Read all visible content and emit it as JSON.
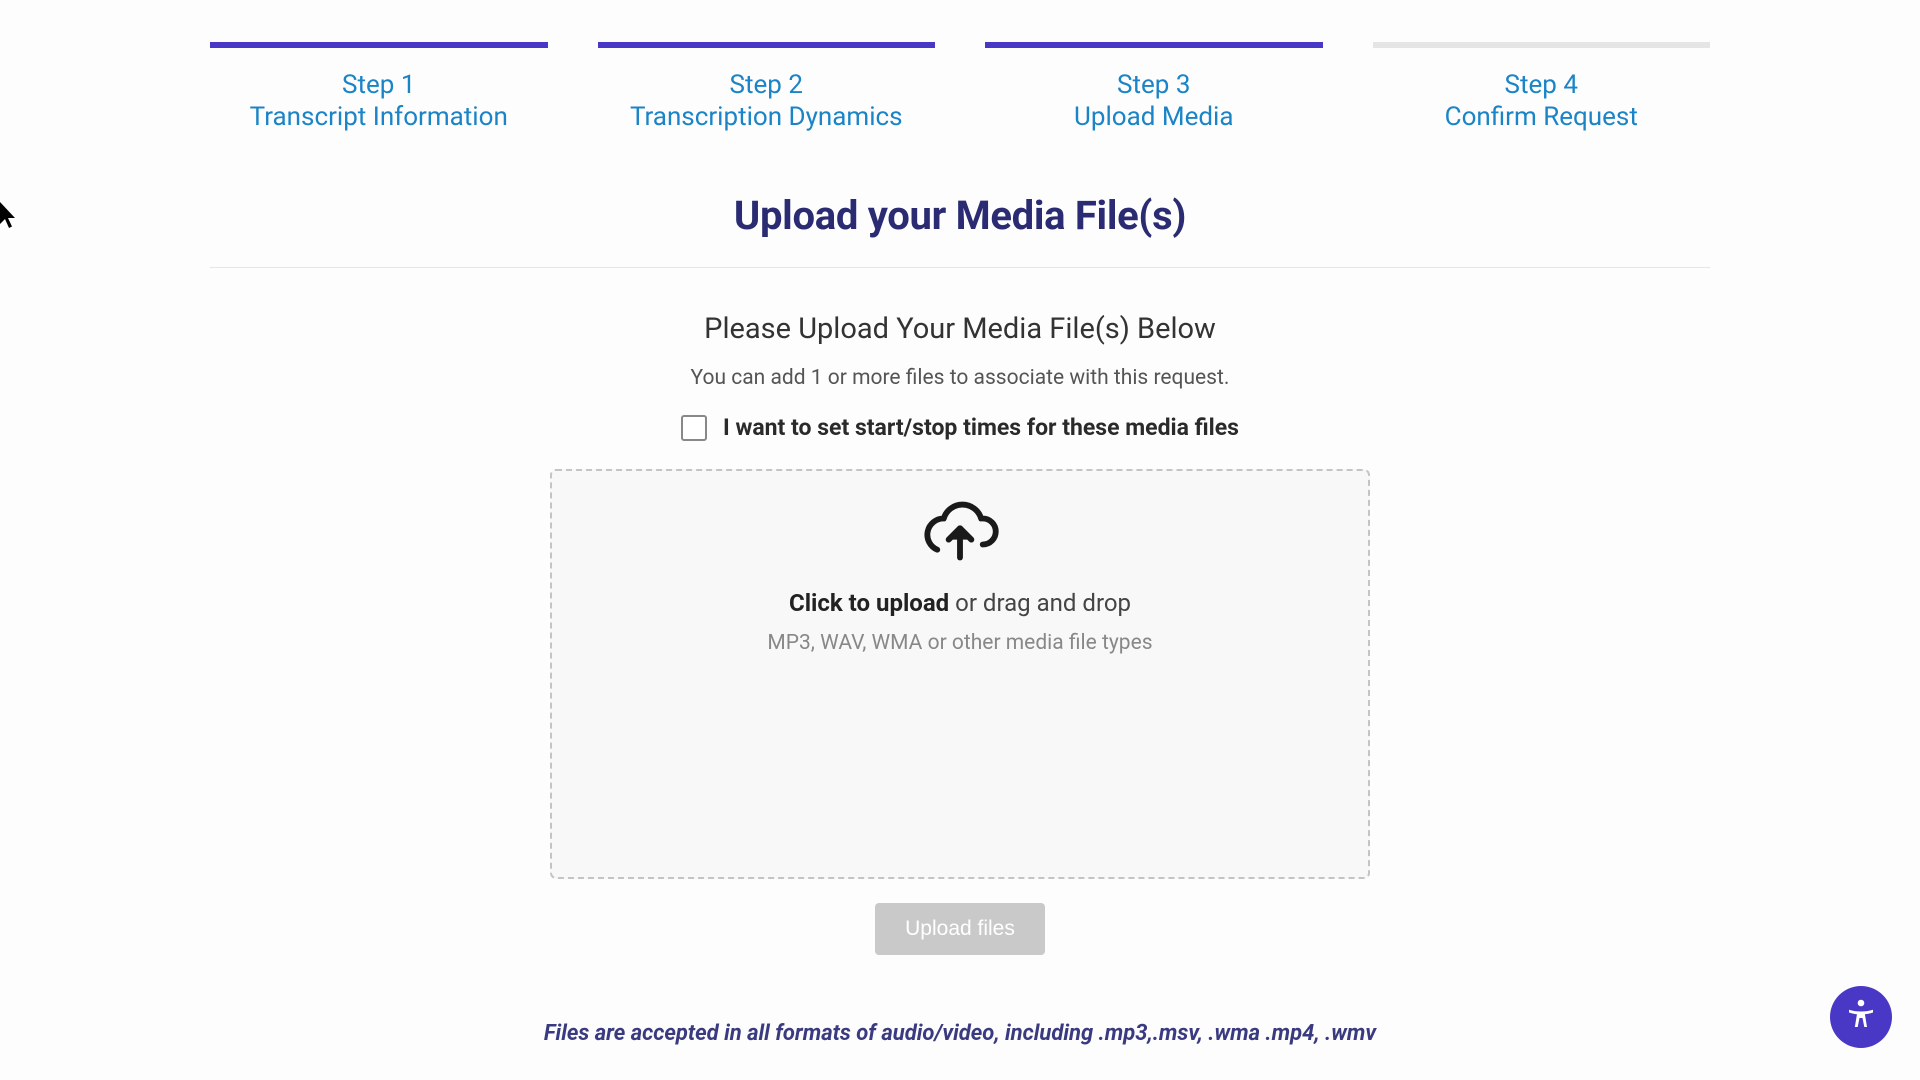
{
  "stepper": {
    "steps": [
      {
        "num": "Step 1",
        "label": "Transcript Information",
        "active": true
      },
      {
        "num": "Step 2",
        "label": "Transcription Dynamics",
        "active": true
      },
      {
        "num": "Step 3",
        "label": "Upload Media",
        "active": true
      },
      {
        "num": "Step 4",
        "label": "Confirm Request",
        "active": false
      }
    ]
  },
  "page": {
    "title": "Upload your Media File(s)",
    "subtitle": "Please Upload Your Media File(s) Below",
    "helper": "You can add 1 or more files to associate with this request.",
    "checkbox_label": "I want to set start/stop times for these media files",
    "dropzone": {
      "main_bold": "Click to upload",
      "main_rest": " or drag and drop",
      "sub": "MP3, WAV, WMA or other media file types"
    },
    "upload_button": "Upload files",
    "footer_note": "Files are accepted in all formats of audio/video, including .mp3,.msv, .wma .mp4, .wmv"
  }
}
